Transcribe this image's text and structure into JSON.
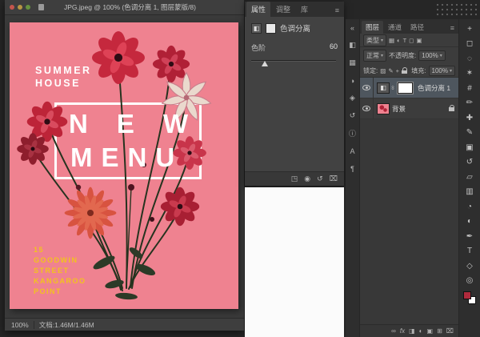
{
  "window": {
    "title": "JPG.jpeg @ 100% (色调分离 1, 图层蒙版/8)",
    "status": {
      "zoom": "100%",
      "doc_info": "文档:1.46M/1.46M"
    }
  },
  "poster": {
    "brand_line1": "SUMMER",
    "brand_line2": "HOUSE",
    "headline_word1": "NEW",
    "headline_word2": "MENU",
    "address_lines": [
      "15",
      "GOODWIN",
      "STREET",
      "KANGAROO",
      "POINT"
    ],
    "colors": {
      "background": "#ef8290",
      "headline": "#ffffff",
      "address": "#f2c21e",
      "flower_red": "#c5283d"
    }
  },
  "properties_panel": {
    "tabs": {
      "t0": "属性",
      "t1": "调整",
      "t2": "库"
    },
    "menu_icon": "≡",
    "adjustment_icon": "◧",
    "adjustment_title": "色调分离",
    "levels_label": "色阶",
    "levels_value": "60",
    "footer": {
      "clip_icon": "◳",
      "visibility_icon": "◉",
      "reset_icon": "↺",
      "delete_icon": "⌧"
    }
  },
  "layers_panel": {
    "tabs": {
      "t0": "图层",
      "t1": "通道",
      "t2": "路径"
    },
    "menu_icon": "≡",
    "filter": {
      "label": "类型",
      "pixel_icon": "▦",
      "adjustment_icon": "◐",
      "type_icon": "T",
      "shape_icon": "◻",
      "smart_icon": "▣"
    },
    "blend_mode": "正常",
    "dropdown_icon": "▾",
    "opacity_label": "不透明度:",
    "opacity_value": "100%",
    "lock_label": "锁定:",
    "lock_icons": {
      "transparent": "▨",
      "paint": "✎",
      "move": "+"
    },
    "fill_label": "填充:",
    "fill_value": "100%",
    "adjustment_thumb_icon": "◧",
    "link_icon": "∞",
    "layers": [
      {
        "name": "色调分离 1"
      },
      {
        "name": "背景"
      }
    ],
    "footer": {
      "link": "∞",
      "effects": "fx",
      "mask": "◨",
      "adjustment": "◐",
      "group": "▣",
      "new_layer": "⊞",
      "delete": "⌧"
    }
  },
  "dock_strip": {
    "icons": [
      {
        "name": "expand-panels",
        "glyph": "«"
      },
      {
        "name": "color",
        "glyph": "◧"
      },
      {
        "name": "swatches",
        "glyph": "▦"
      },
      {
        "name": "adjustments",
        "glyph": "◑"
      },
      {
        "name": "styles",
        "glyph": "◈"
      },
      {
        "name": "history",
        "glyph": "↺"
      },
      {
        "name": "info",
        "glyph": "ⓘ"
      },
      {
        "name": "character",
        "glyph": "A"
      },
      {
        "name": "paragraph",
        "glyph": "¶"
      }
    ]
  },
  "toolbar": {
    "tools": [
      {
        "name": "move-tool",
        "glyph": "+"
      },
      {
        "name": "marquee-tool",
        "glyph": "◻"
      },
      {
        "name": "lasso-tool",
        "glyph": "◌"
      },
      {
        "name": "magic-wand-tool",
        "glyph": "✶"
      },
      {
        "name": "crop-tool",
        "glyph": "#"
      },
      {
        "name": "eyedropper-tool",
        "glyph": "✏"
      },
      {
        "name": "healing-brush-tool",
        "glyph": "✚"
      },
      {
        "name": "brush-tool",
        "glyph": "✎"
      },
      {
        "name": "clone-stamp-tool",
        "glyph": "▣"
      },
      {
        "name": "history-brush-tool",
        "glyph": "↺"
      },
      {
        "name": "eraser-tool",
        "glyph": "▱"
      },
      {
        "name": "gradient-tool",
        "glyph": "▥"
      },
      {
        "name": "blur-tool",
        "glyph": "◔"
      },
      {
        "name": "dodge-tool",
        "glyph": "◐"
      },
      {
        "name": "pen-tool",
        "glyph": "✒"
      },
      {
        "name": "type-tool",
        "glyph": "T"
      },
      {
        "name": "shape-tool",
        "glyph": "◇"
      },
      {
        "name": "zoom-tool",
        "glyph": "◎"
      }
    ],
    "swatch_colors": {
      "foreground": "#b02a3c",
      "background": "#ffffff"
    }
  }
}
